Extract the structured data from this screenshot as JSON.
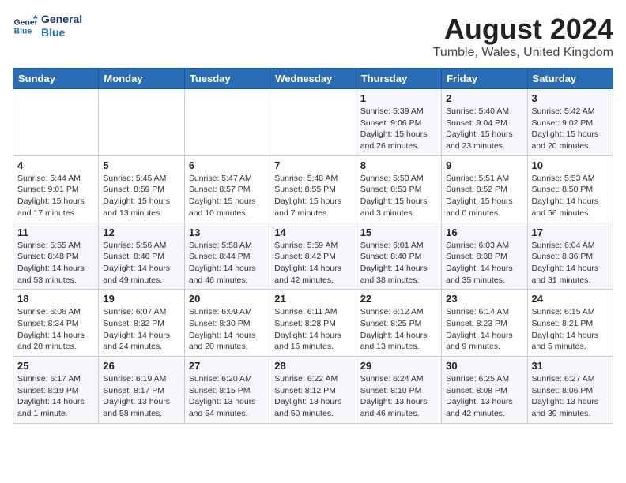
{
  "logo": {
    "line1": "General",
    "line2": "Blue"
  },
  "title": "August 2024",
  "location": "Tumble, Wales, United Kingdom",
  "weekdays": [
    "Sunday",
    "Monday",
    "Tuesday",
    "Wednesday",
    "Thursday",
    "Friday",
    "Saturday"
  ],
  "weeks": [
    [
      {
        "day": "",
        "info": ""
      },
      {
        "day": "",
        "info": ""
      },
      {
        "day": "",
        "info": ""
      },
      {
        "day": "",
        "info": ""
      },
      {
        "day": "1",
        "info": "Sunrise: 5:39 AM\nSunset: 9:06 PM\nDaylight: 15 hours\nand 26 minutes."
      },
      {
        "day": "2",
        "info": "Sunrise: 5:40 AM\nSunset: 9:04 PM\nDaylight: 15 hours\nand 23 minutes."
      },
      {
        "day": "3",
        "info": "Sunrise: 5:42 AM\nSunset: 9:02 PM\nDaylight: 15 hours\nand 20 minutes."
      }
    ],
    [
      {
        "day": "4",
        "info": "Sunrise: 5:44 AM\nSunset: 9:01 PM\nDaylight: 15 hours\nand 17 minutes."
      },
      {
        "day": "5",
        "info": "Sunrise: 5:45 AM\nSunset: 8:59 PM\nDaylight: 15 hours\nand 13 minutes."
      },
      {
        "day": "6",
        "info": "Sunrise: 5:47 AM\nSunset: 8:57 PM\nDaylight: 15 hours\nand 10 minutes."
      },
      {
        "day": "7",
        "info": "Sunrise: 5:48 AM\nSunset: 8:55 PM\nDaylight: 15 hours\nand 7 minutes."
      },
      {
        "day": "8",
        "info": "Sunrise: 5:50 AM\nSunset: 8:53 PM\nDaylight: 15 hours\nand 3 minutes."
      },
      {
        "day": "9",
        "info": "Sunrise: 5:51 AM\nSunset: 8:52 PM\nDaylight: 15 hours\nand 0 minutes."
      },
      {
        "day": "10",
        "info": "Sunrise: 5:53 AM\nSunset: 8:50 PM\nDaylight: 14 hours\nand 56 minutes."
      }
    ],
    [
      {
        "day": "11",
        "info": "Sunrise: 5:55 AM\nSunset: 8:48 PM\nDaylight: 14 hours\nand 53 minutes."
      },
      {
        "day": "12",
        "info": "Sunrise: 5:56 AM\nSunset: 8:46 PM\nDaylight: 14 hours\nand 49 minutes."
      },
      {
        "day": "13",
        "info": "Sunrise: 5:58 AM\nSunset: 8:44 PM\nDaylight: 14 hours\nand 46 minutes."
      },
      {
        "day": "14",
        "info": "Sunrise: 5:59 AM\nSunset: 8:42 PM\nDaylight: 14 hours\nand 42 minutes."
      },
      {
        "day": "15",
        "info": "Sunrise: 6:01 AM\nSunset: 8:40 PM\nDaylight: 14 hours\nand 38 minutes."
      },
      {
        "day": "16",
        "info": "Sunrise: 6:03 AM\nSunset: 8:38 PM\nDaylight: 14 hours\nand 35 minutes."
      },
      {
        "day": "17",
        "info": "Sunrise: 6:04 AM\nSunset: 8:36 PM\nDaylight: 14 hours\nand 31 minutes."
      }
    ],
    [
      {
        "day": "18",
        "info": "Sunrise: 6:06 AM\nSunset: 8:34 PM\nDaylight: 14 hours\nand 28 minutes."
      },
      {
        "day": "19",
        "info": "Sunrise: 6:07 AM\nSunset: 8:32 PM\nDaylight: 14 hours\nand 24 minutes."
      },
      {
        "day": "20",
        "info": "Sunrise: 6:09 AM\nSunset: 8:30 PM\nDaylight: 14 hours\nand 20 minutes."
      },
      {
        "day": "21",
        "info": "Sunrise: 6:11 AM\nSunset: 8:28 PM\nDaylight: 14 hours\nand 16 minutes."
      },
      {
        "day": "22",
        "info": "Sunrise: 6:12 AM\nSunset: 8:25 PM\nDaylight: 14 hours\nand 13 minutes."
      },
      {
        "day": "23",
        "info": "Sunrise: 6:14 AM\nSunset: 8:23 PM\nDaylight: 14 hours\nand 9 minutes."
      },
      {
        "day": "24",
        "info": "Sunrise: 6:15 AM\nSunset: 8:21 PM\nDaylight: 14 hours\nand 5 minutes."
      }
    ],
    [
      {
        "day": "25",
        "info": "Sunrise: 6:17 AM\nSunset: 8:19 PM\nDaylight: 14 hours\nand 1 minute."
      },
      {
        "day": "26",
        "info": "Sunrise: 6:19 AM\nSunset: 8:17 PM\nDaylight: 13 hours\nand 58 minutes."
      },
      {
        "day": "27",
        "info": "Sunrise: 6:20 AM\nSunset: 8:15 PM\nDaylight: 13 hours\nand 54 minutes."
      },
      {
        "day": "28",
        "info": "Sunrise: 6:22 AM\nSunset: 8:12 PM\nDaylight: 13 hours\nand 50 minutes."
      },
      {
        "day": "29",
        "info": "Sunrise: 6:24 AM\nSunset: 8:10 PM\nDaylight: 13 hours\nand 46 minutes."
      },
      {
        "day": "30",
        "info": "Sunrise: 6:25 AM\nSunset: 8:08 PM\nDaylight: 13 hours\nand 42 minutes."
      },
      {
        "day": "31",
        "info": "Sunrise: 6:27 AM\nSunset: 8:06 PM\nDaylight: 13 hours\nand 39 minutes."
      }
    ]
  ]
}
